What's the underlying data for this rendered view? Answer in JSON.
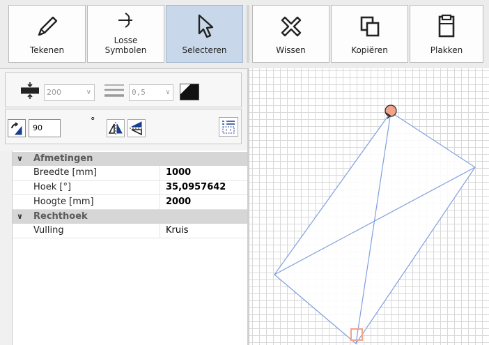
{
  "toolbar": {
    "buttons": [
      {
        "label": "Tekenen"
      },
      {
        "label": "Losse\nSymbolen"
      },
      {
        "label": "Selecteren"
      },
      {
        "label": "Wissen"
      },
      {
        "label": "Kopiëren"
      },
      {
        "label": "Plakken"
      }
    ]
  },
  "line_settings": {
    "width_value": "200",
    "thickness_value": "0,5"
  },
  "rotation": {
    "angle_value": "90",
    "degree_symbol": "°"
  },
  "properties": {
    "categories": [
      {
        "name": "Afmetingen",
        "rows": [
          {
            "key": "Breedte [mm]",
            "value": "1000"
          },
          {
            "key": "Hoek [°]",
            "value": "35,0957642"
          },
          {
            "key": "Hoogte [mm]",
            "value": "2000"
          }
        ]
      },
      {
        "name": "Rechthoek",
        "rows": [
          {
            "key": "Vulling",
            "value": "Kruis"
          }
        ]
      }
    ]
  },
  "colors": {
    "accent_selected": "#c8d8ea",
    "shape_stroke": "#7f9fe0",
    "handle_fill": "#f2a38a",
    "handle_square": "#f2a38a"
  }
}
